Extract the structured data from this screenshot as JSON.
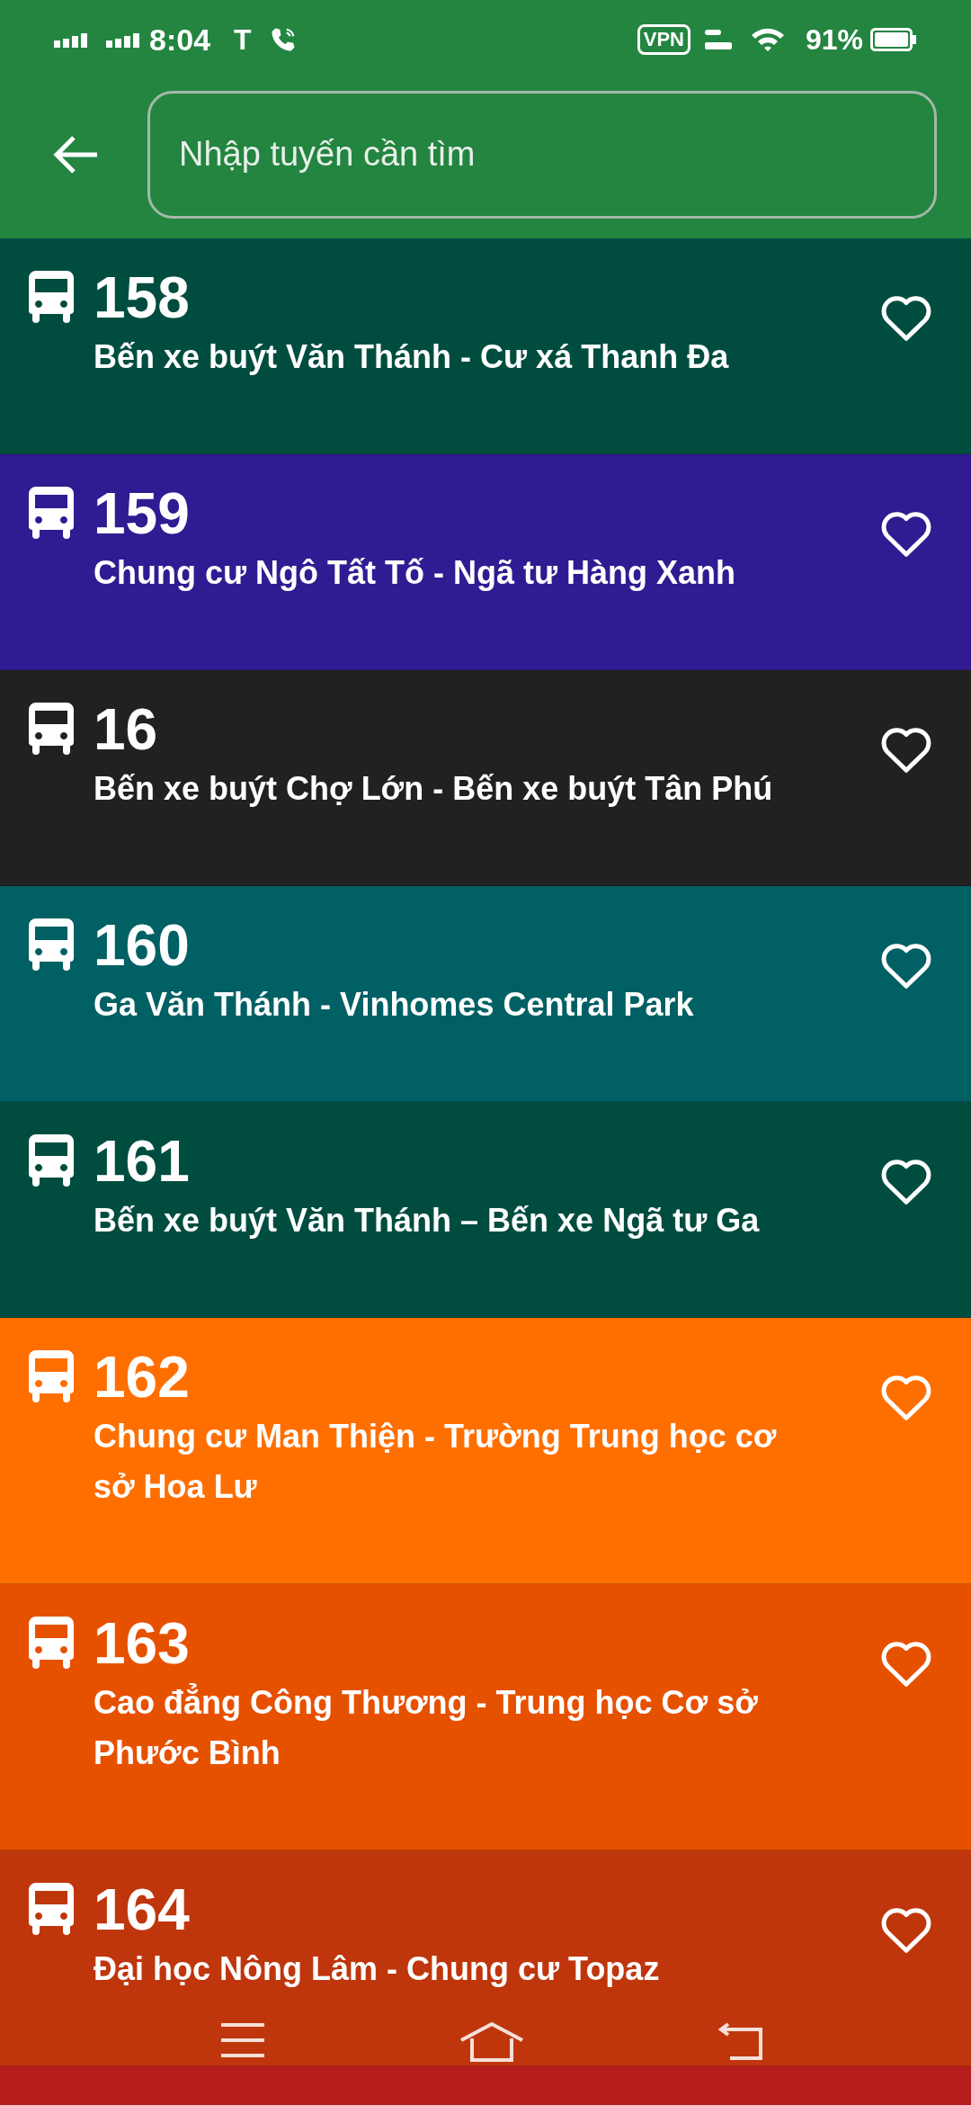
{
  "status_bar": {
    "time": "8:04",
    "carrier": "T",
    "vpn": "VPN",
    "battery": "91%"
  },
  "search": {
    "placeholder": "Nhập tuyến cần tìm"
  },
  "routes": [
    {
      "number": "158",
      "name": "Bến xe buýt Văn Thánh - Cư xá Thanh Đa",
      "color": "#004d40",
      "favorite": false
    },
    {
      "number": "159",
      "name": "Chung cư Ngô Tất Tố - Ngã tư Hàng Xanh",
      "color": "#311b92",
      "favorite": false
    },
    {
      "number": "16",
      "name": "Bến xe buýt Chợ Lớn - Bến xe buýt Tân Phú",
      "color": "#212121",
      "favorite": false
    },
    {
      "number": "160",
      "name": "Ga Văn Thánh - Vinhomes Central Park",
      "color": "#006064",
      "favorite": false
    },
    {
      "number": "161",
      "name": "Bến xe buýt Văn Thánh – Bến xe Ngã tư Ga",
      "color": "#004d40",
      "favorite": false
    },
    {
      "number": "162",
      "name": "Chung cư Man Thiện - Trường Trung học cơ sở Hoa Lư",
      "color": "#ff6f00",
      "favorite": false
    },
    {
      "number": "163",
      "name": "Cao đẳng Công Thương - Trung học Cơ sở Phước Bình",
      "color": "#e65100",
      "favorite": false
    },
    {
      "number": "164",
      "name": "Đại học Nông Lâm - Chung cư Topaz",
      "color": "#bf360c",
      "favorite": false
    }
  ]
}
